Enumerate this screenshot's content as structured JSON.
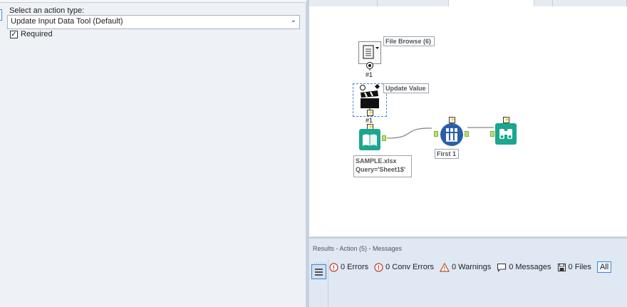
{
  "config": {
    "action_type_label": "Select an action type:",
    "action_type_value": "Update Input Data Tool (Default)",
    "required_label": "Required",
    "required_checked": "✓"
  },
  "canvas": {
    "tools": [
      {
        "id": "file-browse",
        "label": "File Browse (6)",
        "anchor": "#1"
      },
      {
        "id": "update-value",
        "label": "Update Value",
        "anchor": "#1"
      },
      {
        "id": "input-data",
        "label_lines": [
          "SAMPLE.xlsx",
          "Query='Sheet1$'"
        ]
      },
      {
        "id": "sample",
        "label": "First 1"
      },
      {
        "id": "browse",
        "label": ""
      }
    ]
  },
  "results": {
    "title": "Results - Action (5) - Messages",
    "filters": [
      {
        "name": "errors",
        "label": "0 Errors",
        "icon": "error-circle-icon"
      },
      {
        "name": "conv-errors",
        "label": "0 Conv Errors",
        "icon": "error-circle-icon"
      },
      {
        "name": "warnings",
        "label": "0 Warnings",
        "icon": "warning-triangle-icon"
      },
      {
        "name": "messages",
        "label": "0 Messages",
        "icon": "message-bubble-icon"
      },
      {
        "name": "files",
        "label": "0 Files",
        "icon": "save-disk-icon"
      }
    ],
    "all_label": "All"
  },
  "colors": {
    "error": "#c0392b",
    "warning": "#b0551f",
    "accent": "#3f86d4",
    "teal_tool": "#1aa68f",
    "blue_tool": "#2a5ea8"
  }
}
